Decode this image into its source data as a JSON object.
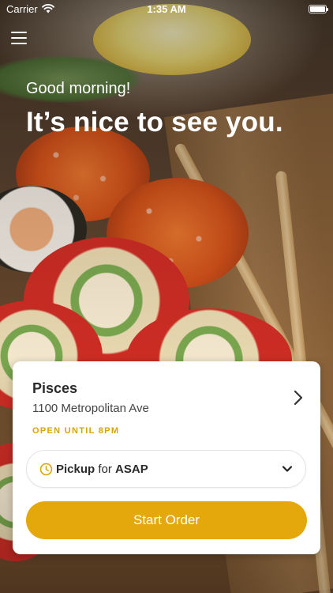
{
  "status_bar": {
    "carrier": "Carrier",
    "time": "1:35 AM",
    "battery_level": 1.0
  },
  "header": {
    "menu_icon": "hamburger-menu-icon",
    "greeting": "Good morning!",
    "headline": "It’s nice to see you."
  },
  "store": {
    "name": "Pisces",
    "address": "1100 Metropolitan Ave",
    "hours": "OPEN UNTIL 8PM",
    "chevron_icon": "chevron-right-icon"
  },
  "order_mode": {
    "icon": "clock-icon",
    "mode": "Pickup",
    "connector": "for",
    "timing": "ASAP",
    "dropdown_icon": "chevron-down-icon"
  },
  "actions": {
    "start_order": "Start Order"
  },
  "colors": {
    "accent": "#E4A80C",
    "hours_text": "#D8A400",
    "card_background": "#FFFFFF"
  }
}
